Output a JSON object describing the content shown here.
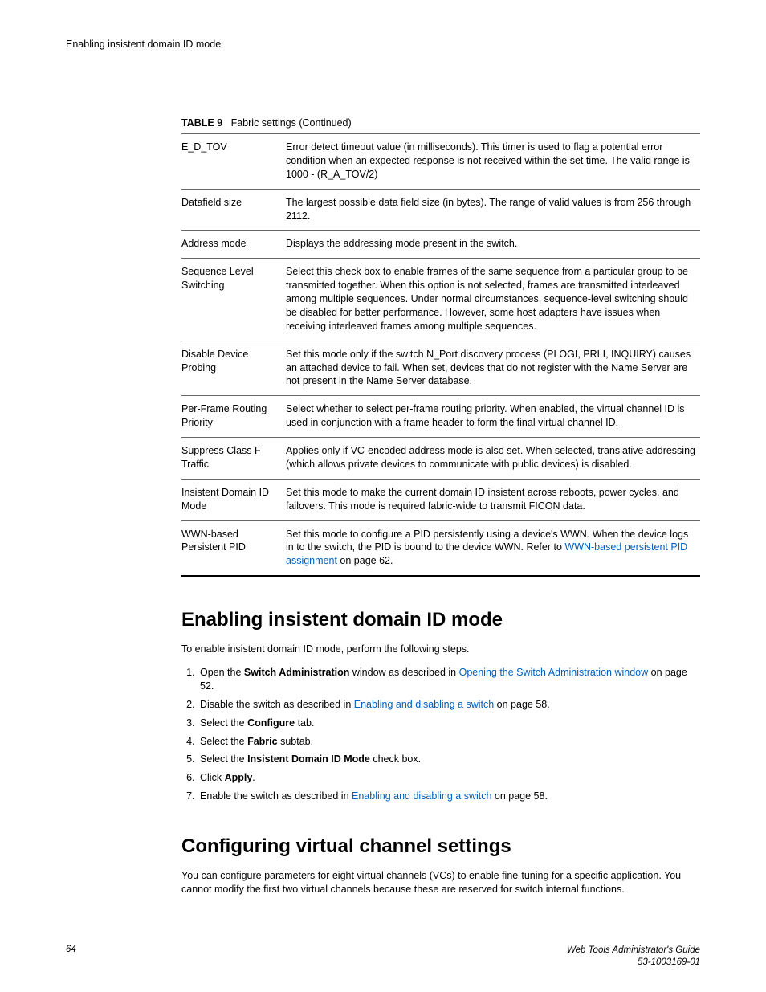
{
  "running_header": "Enabling insistent domain ID mode",
  "table_caption_label": "TABLE 9",
  "table_caption_text": "Fabric settings (Continued)",
  "table_rows": [
    {
      "name": "E_D_TOV",
      "desc": "Error detect timeout value (in milliseconds). This timer is used to flag a potential error condition when an expected response is not received within the set time. The valid range is 1000 - (R_A_TOV/2)"
    },
    {
      "name": "Datafield size",
      "desc": "The largest possible data field size (in bytes). The range of valid values is from 256 through 2112."
    },
    {
      "name": "Address mode",
      "desc": "Displays the addressing mode present in the switch."
    },
    {
      "name": "Sequence Level Switching",
      "desc": "Select this check box to enable frames of the same sequence from a particular group to be transmitted together. When this option is not selected, frames are transmitted interleaved among multiple sequences. Under normal circumstances, sequence-level switching should be disabled for better performance. However, some host adapters have issues when receiving interleaved frames among multiple sequences."
    },
    {
      "name": "Disable Device Probing",
      "desc": "Set this mode only if the switch N_Port discovery process (PLOGI, PRLI, INQUIRY) causes an attached device to fail. When set, devices that do not register with the Name Server are not present in the Name Server database."
    },
    {
      "name": "Per-Frame Routing Priority",
      "desc": "Select whether to select per-frame routing priority. When enabled, the virtual channel ID is used in conjunction with a frame header to form the final virtual channel ID."
    },
    {
      "name": "Suppress Class F Traffic",
      "desc": "Applies only if VC-encoded address mode is also set. When selected, translative addressing (which allows private devices to communicate with public devices) is disabled."
    },
    {
      "name": "Insistent Domain ID Mode",
      "desc": "Set this mode to make the current domain ID insistent across reboots, power cycles, and failovers. This mode is required fabric-wide to transmit FICON data."
    },
    {
      "name": "WWN-based Persistent PID",
      "desc_pre": "Set this mode to configure a PID persistently using a device's WWN. When the device logs in to the switch, the PID is bound to the device WWN. Refer to ",
      "link": "WWN-based persistent PID assignment",
      "desc_post": " on page 62."
    }
  ],
  "section1": {
    "heading": "Enabling insistent domain ID mode",
    "intro": "To enable insistent domain ID mode, perform the following steps.",
    "steps": {
      "s1_pre": "Open the ",
      "s1_bold": "Switch Administration",
      "s1_mid": " window as described in ",
      "s1_link": "Opening the Switch Administration window",
      "s1_post": " on page 52.",
      "s2_pre": "Disable the switch as described in ",
      "s2_link": "Enabling and disabling a switch",
      "s2_post": " on page 58.",
      "s3_pre": "Select the ",
      "s3_bold": "Configure",
      "s3_post": " tab.",
      "s4_pre": "Select the ",
      "s4_bold": "Fabric",
      "s4_post": " subtab.",
      "s5_pre": "Select the ",
      "s5_bold": "Insistent Domain ID Mode",
      "s5_post": " check box.",
      "s6_pre": "Click ",
      "s6_bold": "Apply",
      "s6_post": ".",
      "s7_pre": "Enable the switch as described in ",
      "s7_link": "Enabling and disabling a switch",
      "s7_post": " on page 58."
    }
  },
  "section2": {
    "heading": "Configuring virtual channel settings",
    "body": "You can configure parameters for eight virtual channels (VCs) to enable fine-tuning for a specific application. You cannot modify the first two virtual channels because these are reserved for switch internal functions."
  },
  "footer": {
    "page": "64",
    "title": "Web Tools Administrator's Guide",
    "docnum": "53-1003169-01"
  }
}
